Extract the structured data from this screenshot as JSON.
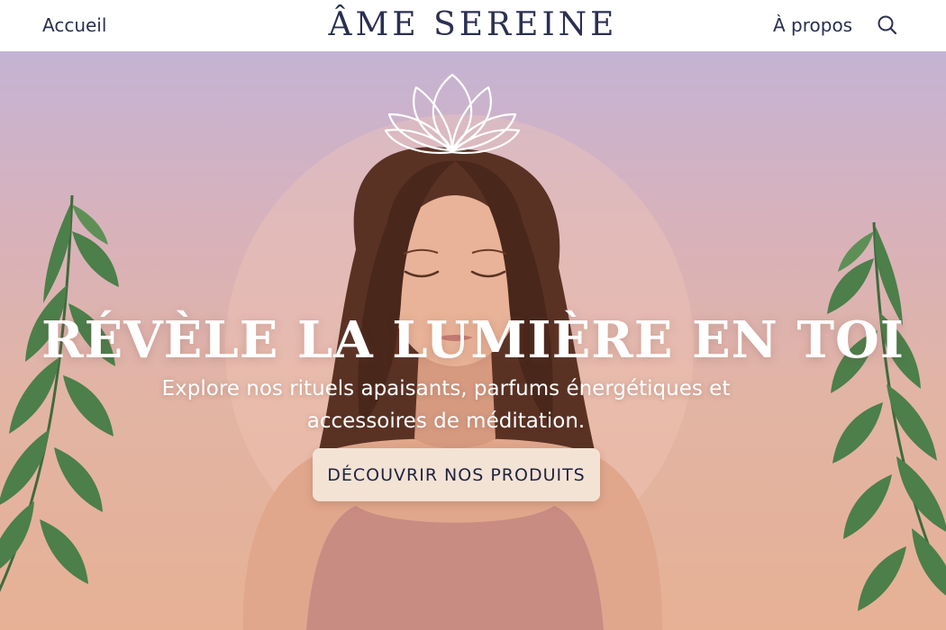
{
  "nav": {
    "home_label": "Accueil",
    "about_label": "À propos",
    "search_icon": "search-icon"
  },
  "brand": {
    "name": "ÂME SEREINE"
  },
  "hero": {
    "headline": "RÉVÈLE LA LUMIÈRE EN TOI",
    "subtitle": "Explore nos rituels apaisants, parfums énergétiques et accessoires de méditation.",
    "cta_label": "DÉCOUVRIR NOS PRODUITS"
  },
  "colors": {
    "brand_navy": "#2b2f52",
    "cta_background": "#f3e3d5",
    "leaf_green": "#4c7f4a",
    "gradient_top": "#c4b3d4",
    "gradient_bottom": "#e6b195"
  },
  "icons": [
    "lotus-icon",
    "search-icon",
    "leaf-branch-left",
    "leaf-branch-right"
  ]
}
